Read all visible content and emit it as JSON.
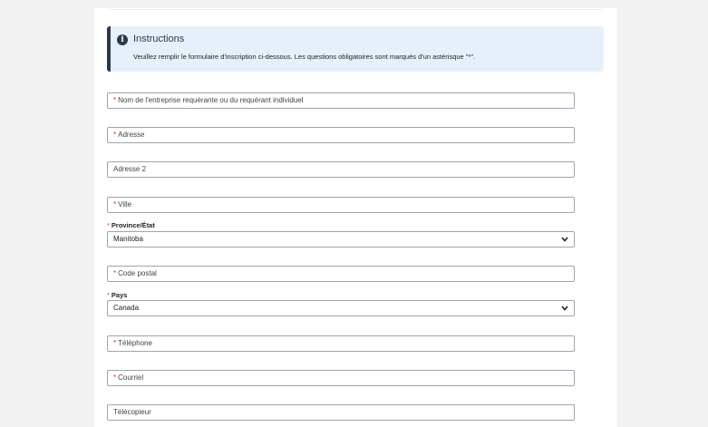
{
  "instructions": {
    "title": "Instructions",
    "text": "Veuillez remplir le formulaire d'inscription ci-dessous. Les questions obligatoires sont marqués d'un astérisque \"*\".",
    "icon": "info-icon"
  },
  "form": {
    "required_marker": "*",
    "company_name_placeholder": "Nom de l'entreprise requérante ou du requérant individuel",
    "address_placeholder": "Adresse",
    "address2_placeholder": "Adresse 2",
    "city_placeholder": "Ville",
    "province_label": "Province/État",
    "province_value": "Manitoba",
    "postal_code_placeholder": "Code postal",
    "country_label": "Pays",
    "country_value": "Canada",
    "phone_placeholder": "Téléphone",
    "email_placeholder": "Courriel",
    "fax_placeholder": "Télécopieur"
  },
  "colors": {
    "accent": "#2b3a4a",
    "required": "#d0392b",
    "info_background": "#e6f0fa"
  }
}
